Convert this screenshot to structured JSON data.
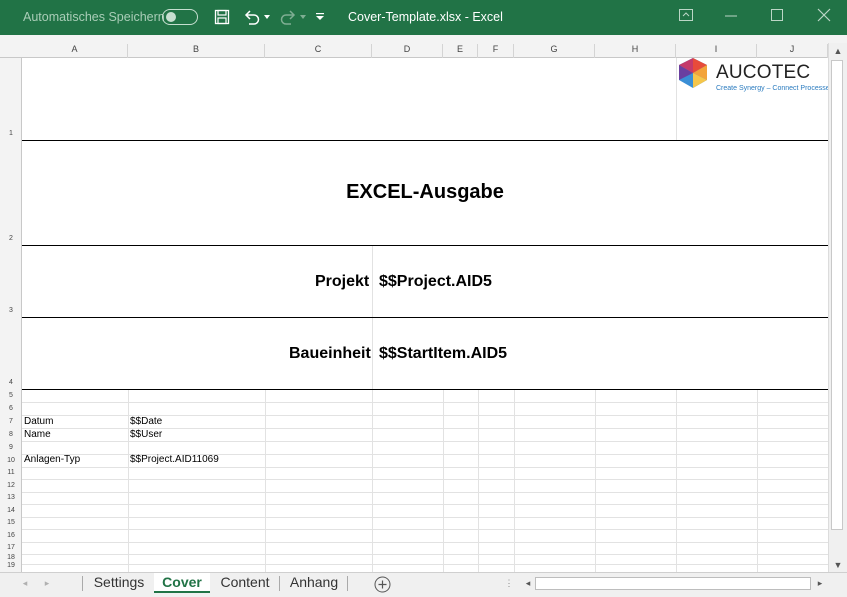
{
  "titlebar": {
    "autosave_label": "Automatisches Speichern",
    "window_title": "Cover-Template.xlsx  -  Excel"
  },
  "columns": [
    "A",
    "B",
    "C",
    "D",
    "E",
    "F",
    "G",
    "H",
    "I",
    "J"
  ],
  "rows": [
    "1",
    "2",
    "3",
    "4",
    "5",
    "6",
    "7",
    "8",
    "9",
    "10",
    "11",
    "12",
    "13",
    "14",
    "15",
    "16",
    "17",
    "18",
    "19"
  ],
  "cells": {
    "title": "EXCEL-Ausgabe",
    "projekt_label": "Projekt",
    "projekt_value": "$$Project.AID5",
    "baueinheit_label": "Baueinheit",
    "baueinheit_value": "$$StartItem.AID5",
    "datum_label": "Datum",
    "datum_value": "$$Date",
    "name_label": "Name",
    "name_value": "$$User",
    "anlagentyp_label": "Anlagen-Typ",
    "anlagentyp_value": "$$Project.AID11069"
  },
  "logo": {
    "name": "AUCOTEC",
    "tagline": "Create Synergy – Connect Processes"
  },
  "tabs": [
    {
      "label": "Settings",
      "active": false
    },
    {
      "label": "Cover",
      "active": true
    },
    {
      "label": "Content",
      "active": false
    },
    {
      "label": "Anhang",
      "active": false
    }
  ],
  "colors": {
    "titlebar": "#217346",
    "active_tab": "#217346"
  }
}
